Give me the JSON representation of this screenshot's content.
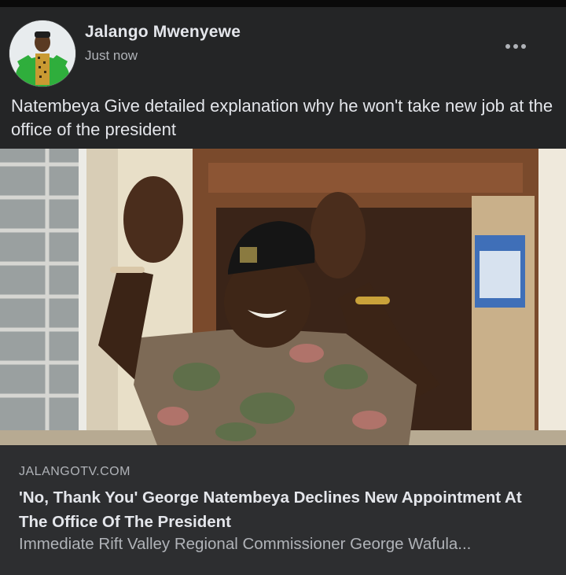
{
  "post": {
    "author_name": "Jalango Mwenyewe",
    "timestamp": "Just now",
    "text": "Natembeya Give detailed explanation why he won't take new job at the office of the president",
    "more_icon": "more-horizontal-icon"
  },
  "link_preview": {
    "domain": "JALANGOTV.COM",
    "headline": "'No, Thank You' George Natembeya Declines New Appointment At The Office Of The President",
    "description": "Immediate Rift Valley Regional Commissioner George Wafula..."
  },
  "colors": {
    "background": "#242526",
    "card_background": "#2d2e30",
    "primary_text": "#e4e6eb",
    "secondary_text": "#b0b3b8"
  }
}
